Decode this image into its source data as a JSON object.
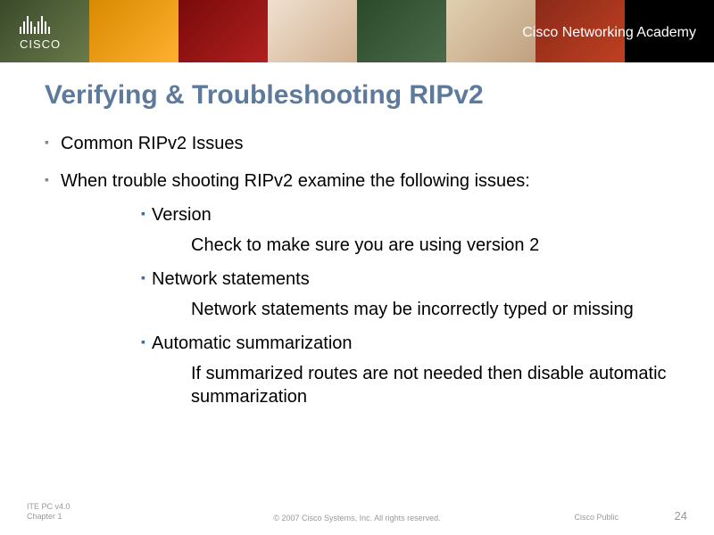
{
  "header": {
    "logo_text": "CISCO",
    "academy_text": "Cisco Networking Academy"
  },
  "slide": {
    "title": "Verifying & Troubleshooting RIPv2",
    "bullets": [
      {
        "text": "Common RIPv2 Issues"
      },
      {
        "text": "When trouble shooting RIPv2 examine the following issues:"
      }
    ],
    "subs": [
      {
        "heading": "Version",
        "body": "Check to make sure you are using version 2"
      },
      {
        "heading": "Network statements",
        "body": "Network statements may be incorrectly typed or missing"
      },
      {
        "heading": "Automatic summarization",
        "body": "If summarized routes are not needed then disable automatic summarization"
      }
    ]
  },
  "footer": {
    "left_line1": "ITE PC v4.0",
    "left_line2": "Chapter 1",
    "copyright": "© 2007 Cisco Systems, Inc. All rights reserved.",
    "public": "Cisco Public",
    "page": "24"
  }
}
